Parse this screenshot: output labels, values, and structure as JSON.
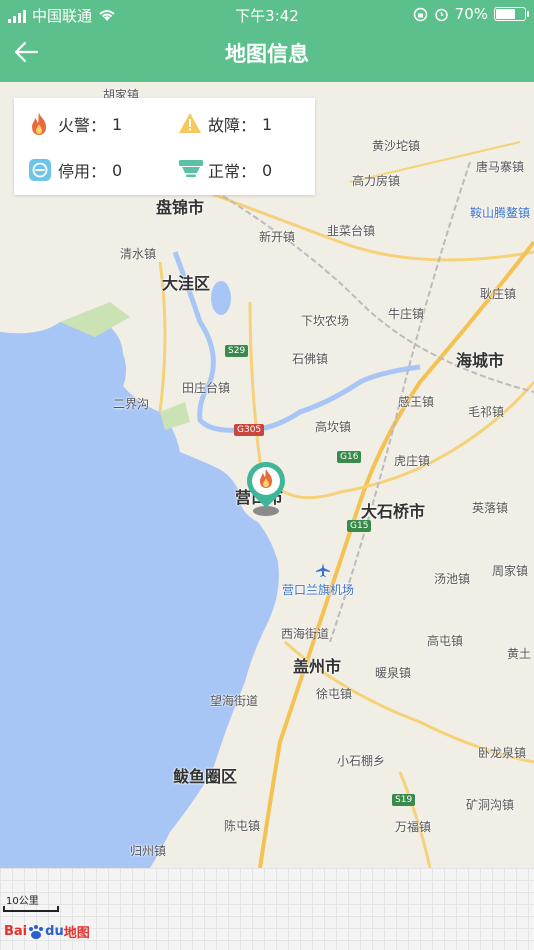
{
  "status_bar": {
    "carrier": "中国联通",
    "time": "下午3:42",
    "battery": "70%",
    "battery_level": 0.7
  },
  "header": {
    "title": "地图信息"
  },
  "stats": {
    "fire_label": "火警：",
    "fire_value": "1",
    "fault_label": "故障：",
    "fault_value": "1",
    "disabled_label": "停用：",
    "disabled_value": "0",
    "normal_label": "正常：",
    "normal_value": "0"
  },
  "map": {
    "labels": {
      "panjin": "盘锦市",
      "dawa": "大洼区",
      "haicheng": "海城市",
      "yingkou": "营口市",
      "dashiqiao": "大石桥市",
      "gaizhou": "盖州市",
      "bayuquan": "鲅鱼圈区",
      "airport": "营口兰旗机场",
      "anshan": "鞍山腾鳌镇",
      "town_jiaxiang": "胡家镇",
      "town_huangsha": "黄沙坨镇",
      "town_tangma": "唐马寨镇",
      "town_gaoli": "高力房镇",
      "town_xinkai": "新开镇",
      "town_jiucai": "韭菜台镇",
      "town_qingshui": "清水镇",
      "town_niuzhuang": "牛庄镇",
      "town_gengzhuang": "耿庄镇",
      "town_xiakan": "下坎农场",
      "town_shifo": "石佛镇",
      "town_tianzhuangtai": "田庄台镇",
      "town_ganwang": "感王镇",
      "town_maoqi": "毛祁镇",
      "town_erjiegou": "二界沟",
      "town_gaokan": "高坎镇",
      "town_huzhuang": "虎庄镇",
      "town_yingluo": "英落镇",
      "town_tangchi": "汤池镇",
      "town_zhoujia": "周家镇",
      "town_xihai": "西海街道",
      "town_gaotun": "高屯镇",
      "town_huangtu": "黄土",
      "town_nuanquan": "暖泉镇",
      "town_xutun": "徐屯镇",
      "town_wanghai": "望海街道",
      "town_wolong": "卧龙泉镇",
      "town_xiaoshipeng": "小石棚乡",
      "town_kuangdong": "矿洞沟镇",
      "town_chentun": "陈屯镇",
      "town_wanfu": "万福镇",
      "town_guizhou": "归州镇"
    },
    "roads": {
      "s29": "S29",
      "g305": "G305",
      "g16": "G16",
      "g15": "G15",
      "s19": "S19"
    }
  },
  "footer": {
    "scale_label": "10公里",
    "logo_bai": "Bai",
    "logo_du": "du",
    "logo_map": "地图"
  }
}
